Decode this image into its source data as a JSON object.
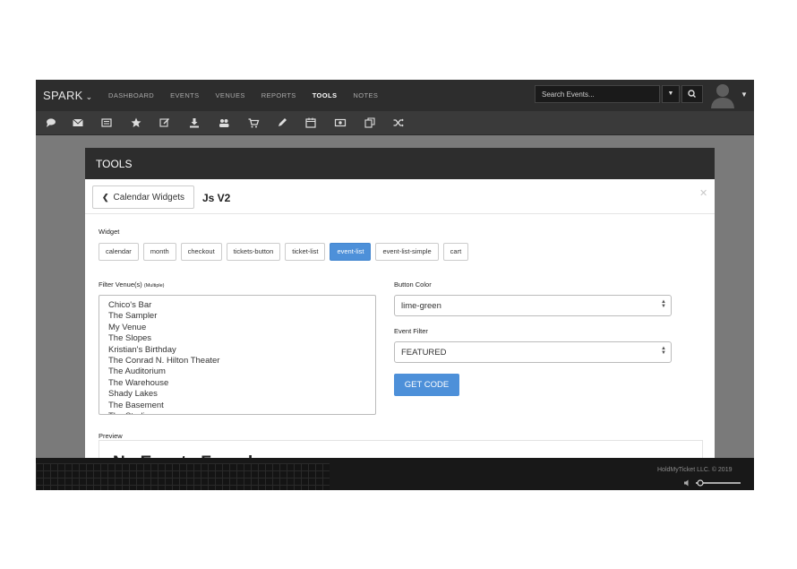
{
  "brand": "SPARK",
  "nav": {
    "dashboard": "DASHBOARD",
    "events": "EVENTS",
    "venues": "VENUES",
    "reports": "REPORTS",
    "tools": "TOOLS",
    "notes": "NOTES"
  },
  "search": {
    "placeholder": "Search Events..."
  },
  "iconbar": [
    "chat-icon",
    "mail-icon",
    "list-icon",
    "star-icon",
    "edit-icon",
    "download-icon",
    "users-icon",
    "cart-icon",
    "pencil-icon",
    "calendar-icon",
    "money-icon",
    "copy-icon",
    "shuffle-icon"
  ],
  "panel": {
    "title": "TOOLS",
    "back_label": "Calendar Widgets",
    "version": "Js V2",
    "widget_label": "Widget",
    "widgets": [
      "calendar",
      "month",
      "checkout",
      "tickets-button",
      "ticket-list",
      "event-list",
      "event-list-simple",
      "cart"
    ],
    "active_widget": "event-list",
    "filter_label": "Filter Venue(s)",
    "filter_hint": "(Multiple)",
    "venues": [
      "Chico's Bar",
      "The Sampler",
      "My Venue",
      "The Slopes",
      "Kristian's Birthday",
      "The Conrad N. Hilton Theater",
      "The Auditorium",
      "The Warehouse",
      "Shady Lakes",
      "The Basement",
      "The Stadium"
    ],
    "button_color_label": "Button Color",
    "button_color": "lime-green",
    "event_filter_label": "Event Filter",
    "event_filter": "FEATURED",
    "get_code": "GET CODE",
    "preview_label": "Preview",
    "preview_text": "No Events Found"
  },
  "footer": {
    "copyright": "HoldMyTicket LLC. © 2019"
  },
  "colors": {
    "nav_bg": "#2d2d2d",
    "accent": "#4d90d9"
  }
}
